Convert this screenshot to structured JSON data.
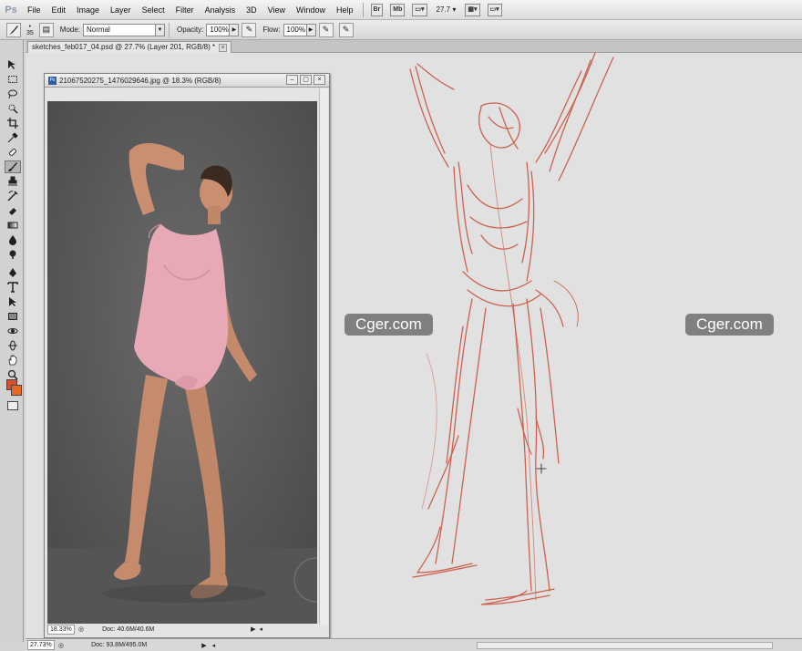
{
  "app": {
    "logo": "Ps"
  },
  "menubar": {
    "items": [
      "File",
      "Edit",
      "Image",
      "Layer",
      "Select",
      "Filter",
      "Analysis",
      "3D",
      "View",
      "Window",
      "Help"
    ],
    "zoom": "27.7",
    "icons": [
      "bridge-icon",
      "minibridge-icon",
      "layout-icon",
      "arrange-icon",
      "screen-mode-icon"
    ]
  },
  "options": {
    "brush_size": "35",
    "mode_label": "Mode:",
    "mode_value": "Normal",
    "opacity_label": "Opacity:",
    "opacity_value": "100%",
    "flow_label": "Flow:",
    "flow_value": "100%"
  },
  "document": {
    "tab_title": "sketches_feb017_04.psd @ 27.7% (Layer 201, RGB/8) *",
    "zoom": "27.73%",
    "doc_size": "Doc: 93.8M/495.0M"
  },
  "reference": {
    "title": "21067520275_1476029646.jpg @ 18.3% (RGB/8)",
    "zoom": "18.33%",
    "doc_size": "Doc: 40.6M/40.6M"
  },
  "watermarks": [
    "Cger.com",
    "Cger.com"
  ],
  "colors": {
    "foreground": "#d94f2b",
    "background": "#e36a20",
    "sketch": "#c9553f"
  },
  "tools": [
    "move-tool-icon",
    "marquee-tool-icon",
    "lasso-tool-icon",
    "quick-select-icon",
    "crop-tool-icon",
    "eyedropper-icon",
    "healing-brush-icon",
    "brush-tool-icon",
    "stamp-tool-icon",
    "history-brush-icon",
    "eraser-tool-icon",
    "gradient-tool-icon",
    "blur-tool-icon",
    "dodge-tool-icon",
    "pen-tool-icon",
    "type-tool-icon",
    "path-select-icon",
    "shape-tool-icon",
    "3d-rotate-icon",
    "3d-orbit-icon",
    "hand-tool-icon",
    "zoom-tool-icon"
  ]
}
